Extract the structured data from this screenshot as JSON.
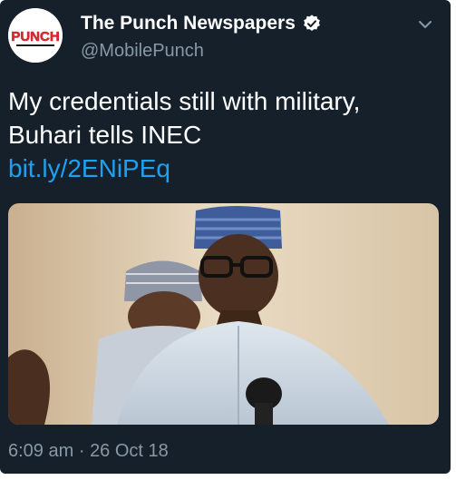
{
  "tweet": {
    "author": {
      "display_name": "The Punch Newspapers",
      "handle": "@MobilePunch",
      "avatar_text": "PUNCH",
      "verified_icon": "verified-badge-icon"
    },
    "text_lines": [
      "My credentials still with military,",
      "Buhari tells INEC"
    ],
    "link": "bit.ly/2ENiPEq",
    "time": "6:09 am",
    "separator": "·",
    "date": "26 Oct 18",
    "menu_icon": "chevron-down-icon"
  },
  "colors": {
    "background": "#15202b",
    "text": "#ffffff",
    "secondary_text": "#8899a6",
    "link": "#1da1f2",
    "punch_red": "#d7282f"
  }
}
